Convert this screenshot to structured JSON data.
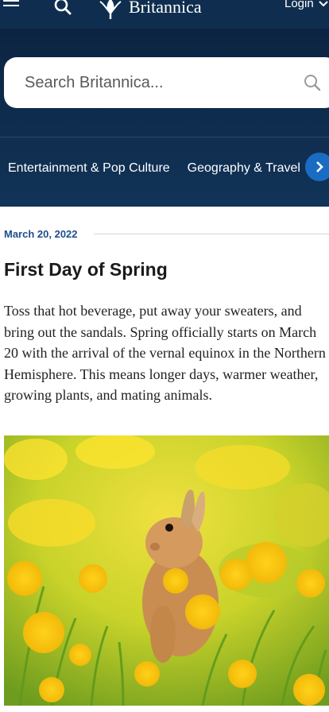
{
  "header": {
    "logo_text": "Britannica",
    "login_label": "Login"
  },
  "search": {
    "placeholder": "Search Britannica..."
  },
  "categories": {
    "items": [
      "Entertainment & Pop Culture",
      "Geography & Travel"
    ]
  },
  "article": {
    "date": "March 20, 2022",
    "title": "First Day of Spring",
    "body": "Toss that hot beverage, put away your sweaters, and bring out the sandals. Spring officially starts on March 20 with the arrival of the vernal equinox in the Northern Hemisphere. This means longer days, warmer weather, growing plants, and mating animals.",
    "image_subject": "rabbit-in-dandelion-field"
  },
  "colors": {
    "header_bg": "#0f2e4f",
    "accent_blue": "#1a6cc2",
    "date_blue": "#1d4f8a"
  },
  "icons": [
    "hamburger-icon",
    "search-icon",
    "britannica-thistle-logo",
    "chevron-down-icon",
    "chevron-right-icon"
  ]
}
